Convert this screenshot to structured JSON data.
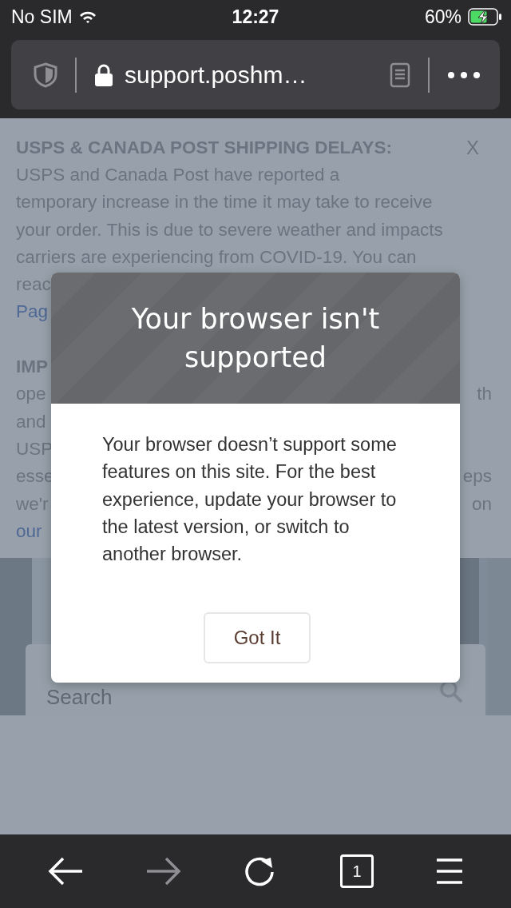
{
  "status_bar": {
    "carrier": "No SIM",
    "time": "12:27",
    "battery": "60%",
    "charging": true
  },
  "address_bar": {
    "url": "support.poshm…"
  },
  "banner": {
    "title": "USPS & CANADA POST SHIPPING DELAYS:",
    "close": "X",
    "lines": [
      "USPS and Canada Post have reported a",
      "temporary increase in the time it may take to receive",
      "your order. This is due to severe weather and impacts",
      "carriers are experiencing from COVID-19. You can"
    ],
    "covered_lines": [
      {
        "left": "reac",
        "kind": "text"
      },
      {
        "left": "Pag",
        "kind": "link"
      },
      {
        "kind": "blank"
      },
      {
        "left": "IMP",
        "kind": "heading"
      },
      {
        "left": "ope",
        "right": "th",
        "kind": "text"
      },
      {
        "left": "and",
        "kind": "text"
      },
      {
        "left": "USP",
        "kind": "text"
      },
      {
        "left": "esse",
        "right": "eps",
        "kind": "text"
      },
      {
        "left": "we'r",
        "right": "on",
        "kind": "text"
      },
      {
        "left": "our",
        "kind": "link"
      }
    ]
  },
  "search": {
    "placeholder": "Search"
  },
  "dialog": {
    "title": "Your browser isn't supported",
    "message": "Your browser doesn’t support some features on this site. For the best experience, update your browser to the latest version, or switch to another browser.",
    "button": "Got It"
  },
  "toolbar": [
    {
      "kind": "back",
      "disabled": false
    },
    {
      "kind": "forward",
      "disabled": true
    },
    {
      "kind": "reload",
      "disabled": false
    },
    {
      "kind": "tabs",
      "count": "1",
      "disabled": false
    },
    {
      "kind": "menu",
      "disabled": false
    }
  ]
}
